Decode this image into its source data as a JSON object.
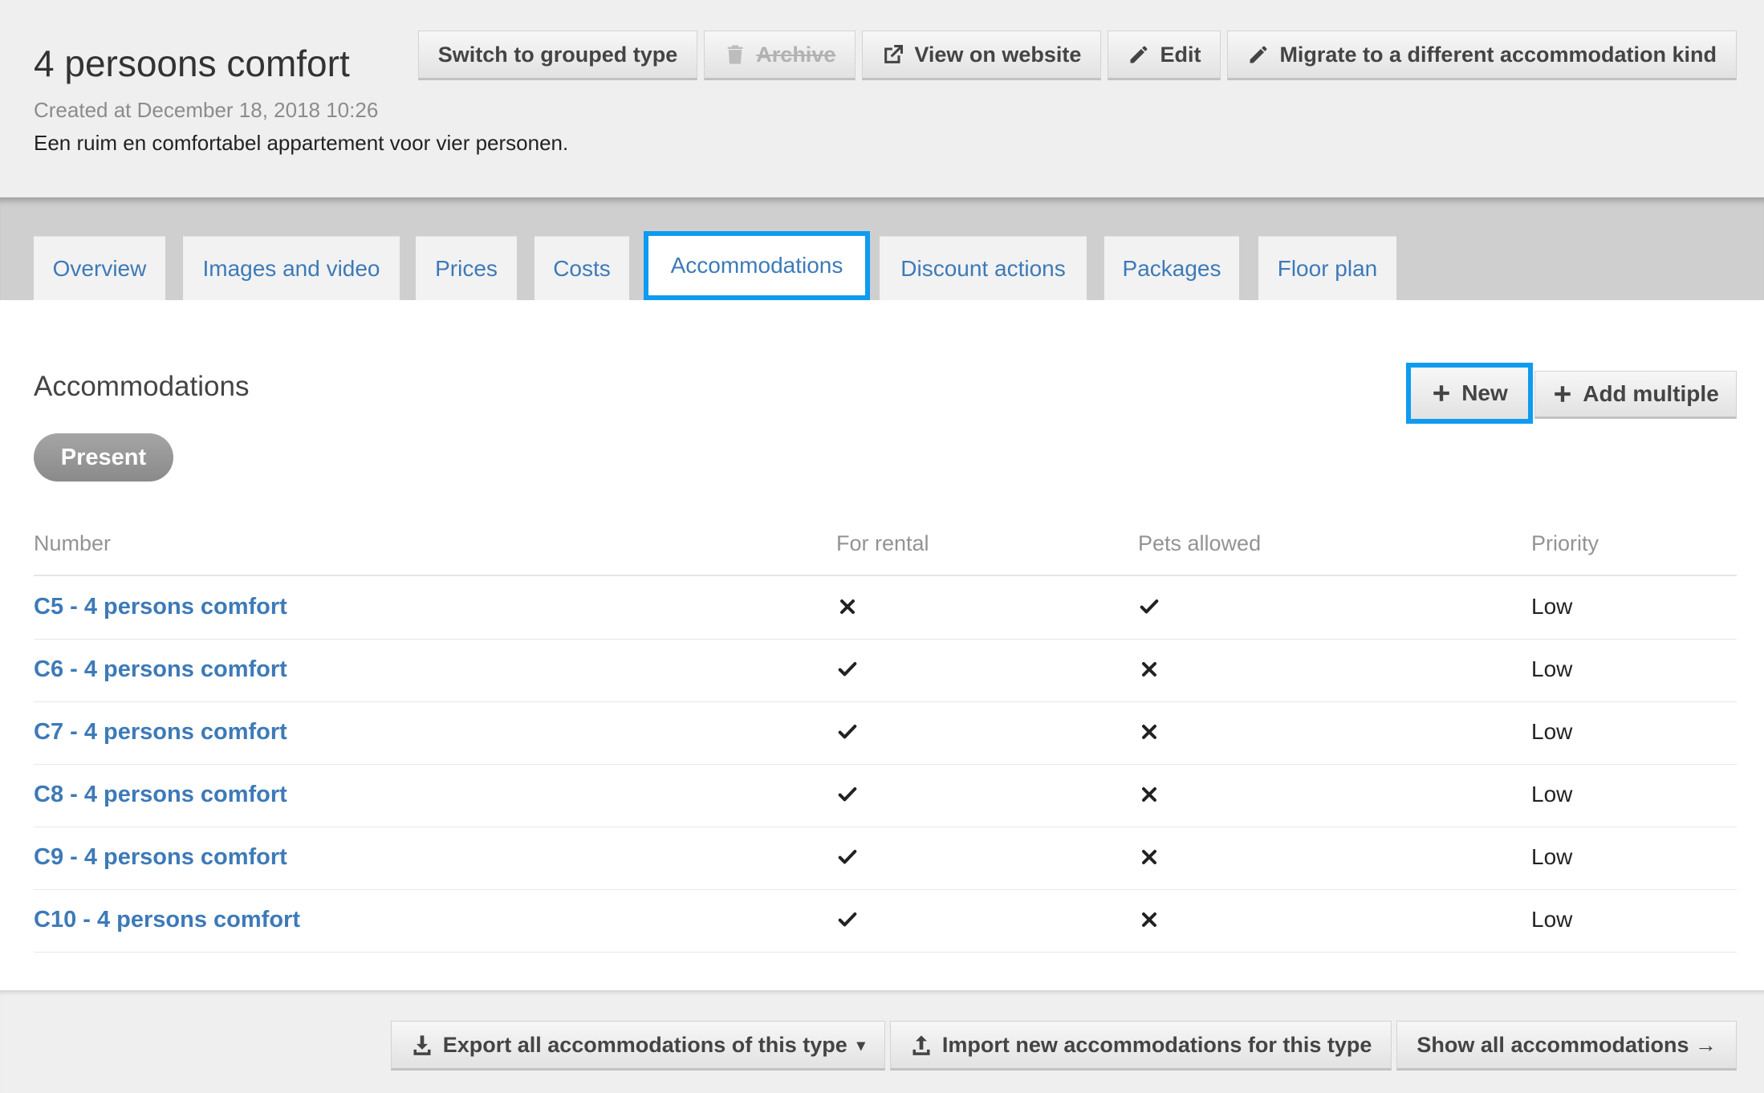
{
  "header": {
    "title": "4 persoons comfort",
    "created": "Created at December 18, 2018 10:26",
    "description": "Een ruim en comfortabel appartement voor vier personen."
  },
  "toolbar": {
    "switch_label": "Switch to grouped type",
    "archive_label": "Archive",
    "view_label": "View on website",
    "edit_label": "Edit",
    "migrate_label": "Migrate to a different accommodation kind"
  },
  "tabs": [
    {
      "label": "Overview"
    },
    {
      "label": "Images and video"
    },
    {
      "label": "Prices"
    },
    {
      "label": "Costs"
    },
    {
      "label": "Accommodations"
    },
    {
      "label": "Discount actions"
    },
    {
      "label": "Packages"
    },
    {
      "label": "Floor plan"
    }
  ],
  "active_tab": "Accommodations",
  "section": {
    "title": "Accommodations",
    "new_label": "New",
    "add_multiple_label": "Add multiple",
    "filter_label": "Present"
  },
  "table": {
    "headers": [
      "Number",
      "For rental",
      "Pets allowed",
      "Priority"
    ],
    "rows": [
      {
        "number": "C5 - 4 persons comfort",
        "for_rental": false,
        "pets_allowed": true,
        "priority": "Low"
      },
      {
        "number": "C6 - 4 persons comfort",
        "for_rental": true,
        "pets_allowed": false,
        "priority": "Low"
      },
      {
        "number": "C7 - 4 persons comfort",
        "for_rental": true,
        "pets_allowed": false,
        "priority": "Low"
      },
      {
        "number": "C8 - 4 persons comfort",
        "for_rental": true,
        "pets_allowed": false,
        "priority": "Low"
      },
      {
        "number": "C9 - 4 persons comfort",
        "for_rental": true,
        "pets_allowed": false,
        "priority": "Low"
      },
      {
        "number": "C10 - 4 persons comfort",
        "for_rental": true,
        "pets_allowed": false,
        "priority": "Low"
      }
    ]
  },
  "footer": {
    "export_label": "Export all accommodations of this type",
    "import_label": "Import new accommodations for this type",
    "show_all_label": "Show all accommodations →"
  },
  "colors": {
    "link": "#3d7ab8",
    "highlight": "#0e9bf0"
  }
}
